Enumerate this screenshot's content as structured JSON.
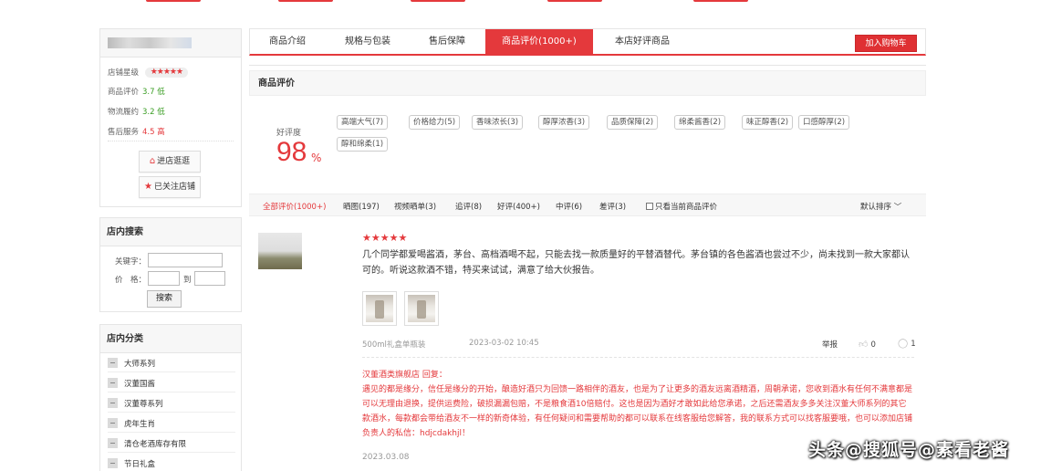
{
  "shop": {
    "rating_label": "店铺星级",
    "rating_stars": "★★★★★",
    "metrics": [
      {
        "label": "商品评价",
        "value": "3.7 低"
      },
      {
        "label": "物流履约",
        "value": "3.2 低"
      },
      {
        "label": "售后服务",
        "value": "4.5 高"
      }
    ],
    "enter_shop_label": "进店逛逛",
    "follow_label": "已关注店铺"
  },
  "search": {
    "title": "店内搜索",
    "keyword_label": "关键字：",
    "price_label": "价　格：",
    "to_label": "到",
    "button_label": "搜索"
  },
  "categories": {
    "title": "店内分类",
    "items": [
      "大师系列",
      "汉董国酱",
      "汉董尊系列",
      "虎年生肖",
      "清仓老酒库存有限",
      "节日礼盒"
    ]
  },
  "tabs": [
    "商品介绍",
    "规格与包装",
    "售后保障",
    "商品评价(1000+)",
    "本店好评商品"
  ],
  "cart_label": "加入购物车",
  "review": {
    "section_title": "商品评价",
    "rate_label": "好评度",
    "rate_value": "98",
    "rate_unit": "%",
    "tags": [
      "高端大气(7)",
      "价格给力(5)",
      "香味浓长(3)",
      "醇厚浓香(3)",
      "品质保障(2)",
      "绵柔酱香(2)",
      "味正醇香(2)",
      "口感醇厚(2)",
      "醇和绵柔(1)"
    ],
    "filters": [
      "全部评价(1000+)",
      "晒图(197)",
      "视频晒单(3)",
      "追评(8)",
      "好评(400+)",
      "中评(6)",
      "差评(3)"
    ],
    "only_current_label": "只看当前商品评价",
    "sort_label": "默认排序",
    "sort_icon": "chevron-down",
    "item": {
      "stars": "★★★★★",
      "text": "几个同学都爱喝酱酒，茅台、高档酒喝不起，只能去找一款质量好的平替酒替代。茅台镇的各色酱酒也尝过不少，尚未找到一款大家都认可的。听说这款酒不错，特买来试试，满意了给大伙报告。",
      "spec": "500ml礼盒单瓶装",
      "date": "2023-03-02 10:45",
      "report_label": "举报",
      "like_count": "0",
      "comment_count": "1",
      "reply_header": "汉董酒类旗舰店 回复：",
      "reply_text": "遇见的都是缘分，信任是缘分的开始，酿造好酒只为回馈一路相伴的酒友，也是为了让更多的酒友远离酒精酒，周朝承诺，您收到酒水有任何不满意都是可以无理由退换，提供运费险，破损漏漏包赔，不是粮食酒10倍赔付。这也是因为酒好才敢如此给您承诺，之后还需酒友多多关注汉董大师系列的其它款酒水，每款都会带给酒友不一样的新奇体验，有任何疑问和需要帮助的都可以联系在线客服给您解答，我的联系方式可以找客服要哦，也可以添加店铺负责人的私信：hdjcdakhjl！",
      "reply_date": "2023.03.08"
    }
  },
  "watermark": "头条@搜狐号@素看老酱",
  "colors": {
    "accent": "#e4393c",
    "green": "#3a9d23"
  }
}
